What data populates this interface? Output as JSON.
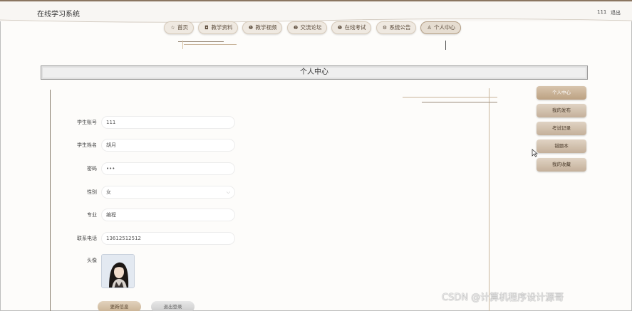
{
  "header": {
    "site_title": "在线学习系统",
    "user_name": "111",
    "logout_label": "退出"
  },
  "nav": {
    "items": [
      {
        "label": "首页",
        "icon": "star-icon",
        "glyph": "☆"
      },
      {
        "label": "教学资料",
        "icon": "bag-icon",
        "glyph": "◘"
      },
      {
        "label": "教学视频",
        "icon": "info-circle-icon",
        "glyph": "❶"
      },
      {
        "label": "交流论坛",
        "icon": "help-circle-icon",
        "glyph": "❷"
      },
      {
        "label": "在线考试",
        "icon": "info-circle-icon",
        "glyph": "❶"
      },
      {
        "label": "系统公告",
        "icon": "gear-icon",
        "glyph": "⚙"
      },
      {
        "label": "个人中心",
        "icon": "user-icon",
        "glyph": "♙"
      }
    ],
    "active_index": 6
  },
  "page_title": "个人中心",
  "form": {
    "account": {
      "label": "学生账号",
      "value": "111"
    },
    "name": {
      "label": "学生姓名",
      "value": "胡月"
    },
    "password": {
      "label": "密码",
      "value": "•••"
    },
    "gender": {
      "label": "性别",
      "value": "女"
    },
    "major": {
      "label": "专业",
      "value": "编程"
    },
    "phone": {
      "label": "联系电话",
      "value": "13612512512"
    },
    "avatar_label": "头像"
  },
  "buttons": {
    "update": "更新信息",
    "logout": "退出登录"
  },
  "sidebar": {
    "items": [
      {
        "label": "个人中心",
        "active": true
      },
      {
        "label": "我的发布",
        "active": false
      },
      {
        "label": "考试记录",
        "active": false
      },
      {
        "label": "错题本",
        "active": false
      },
      {
        "label": "我的收藏",
        "active": false
      }
    ]
  },
  "watermark": "CSDN @计算机程序设计源哥",
  "colors": {
    "accent": "#8a7560",
    "nav_bg": "#efe9e1",
    "side_active": "#bca182"
  }
}
